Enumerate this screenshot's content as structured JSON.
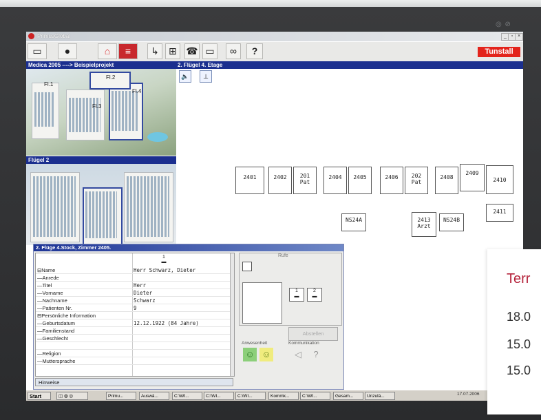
{
  "window": {
    "title": "PrimusGlobal",
    "brand": "Tunstall",
    "project_path": "Medica 2005 ----> Beispielprojekt",
    "floor_title": "2. Flügel 4. Etage",
    "wing_label": "Flügel 2",
    "help_label": "?"
  },
  "campus_labels": [
    "Fl.1",
    "Fl.2",
    "Fl.3",
    "Fl.4"
  ],
  "rooms": [
    {
      "label": "2401"
    },
    {
      "label": "2402"
    },
    {
      "label": "201\nPat"
    },
    {
      "label": "2404"
    },
    {
      "label": "2405"
    },
    {
      "label": "2406"
    },
    {
      "label": "202\nPat"
    },
    {
      "label": "2408"
    },
    {
      "label": "2409"
    },
    {
      "label": "2410"
    },
    {
      "label": "2411"
    },
    {
      "label": "NS24A"
    },
    {
      "label": "2413\nArzt"
    },
    {
      "label": "NS24B"
    }
  ],
  "detail": {
    "title": "2. Flüge 4.Stock, Zimmer 2405.",
    "bed_label": "1",
    "rows": [
      {
        "label": "⊟Name",
        "value": "Herr Schwarz, Dieter"
      },
      {
        "label": "—Anrede",
        "value": ""
      },
      {
        "label": "—Titel",
        "value": "Herr"
      },
      {
        "label": "—Vorname",
        "value": "Dieter"
      },
      {
        "label": "—Nachname",
        "value": "Schwarz"
      },
      {
        "label": "—Patienten Nr.",
        "value": "9"
      },
      {
        "label": "⊟Persönliche Information",
        "value": ""
      },
      {
        "label": "—Geburtsdatum",
        "value": "12.12.1922 (84 Jahre)"
      },
      {
        "label": "—Familienstand",
        "value": ""
      },
      {
        "label": "—Geschlecht",
        "value": ""
      },
      {
        "label": "",
        "value": ""
      },
      {
        "label": "—Religion",
        "value": ""
      },
      {
        "label": "—Muttersprache",
        "value": ""
      }
    ],
    "hinweise": "Hinweise",
    "rufe": "Rufe",
    "bed1": "1",
    "bed2": "2",
    "abstellen": "Abstellen",
    "anwesenheit": "Anwesenheit",
    "kommunikation": "Kommunikation"
  },
  "taskbar": {
    "start": "Start",
    "tasks": [
      "Primu...",
      "Auswä...",
      "C:\\WI...",
      "C:\\WI...",
      "C:\\WI...",
      "Kommk...",
      "C:\\WI...",
      "Gesam...",
      "Unzulä..."
    ],
    "date": "17.07.2006"
  },
  "overlay": {
    "title": "Terr",
    "dates": [
      "18.0",
      "15.0",
      "15.0"
    ]
  },
  "colors": {
    "accent_blue": "#1b2f8f",
    "brand_red": "#e3241b",
    "overlay_red": "#b5233b"
  }
}
